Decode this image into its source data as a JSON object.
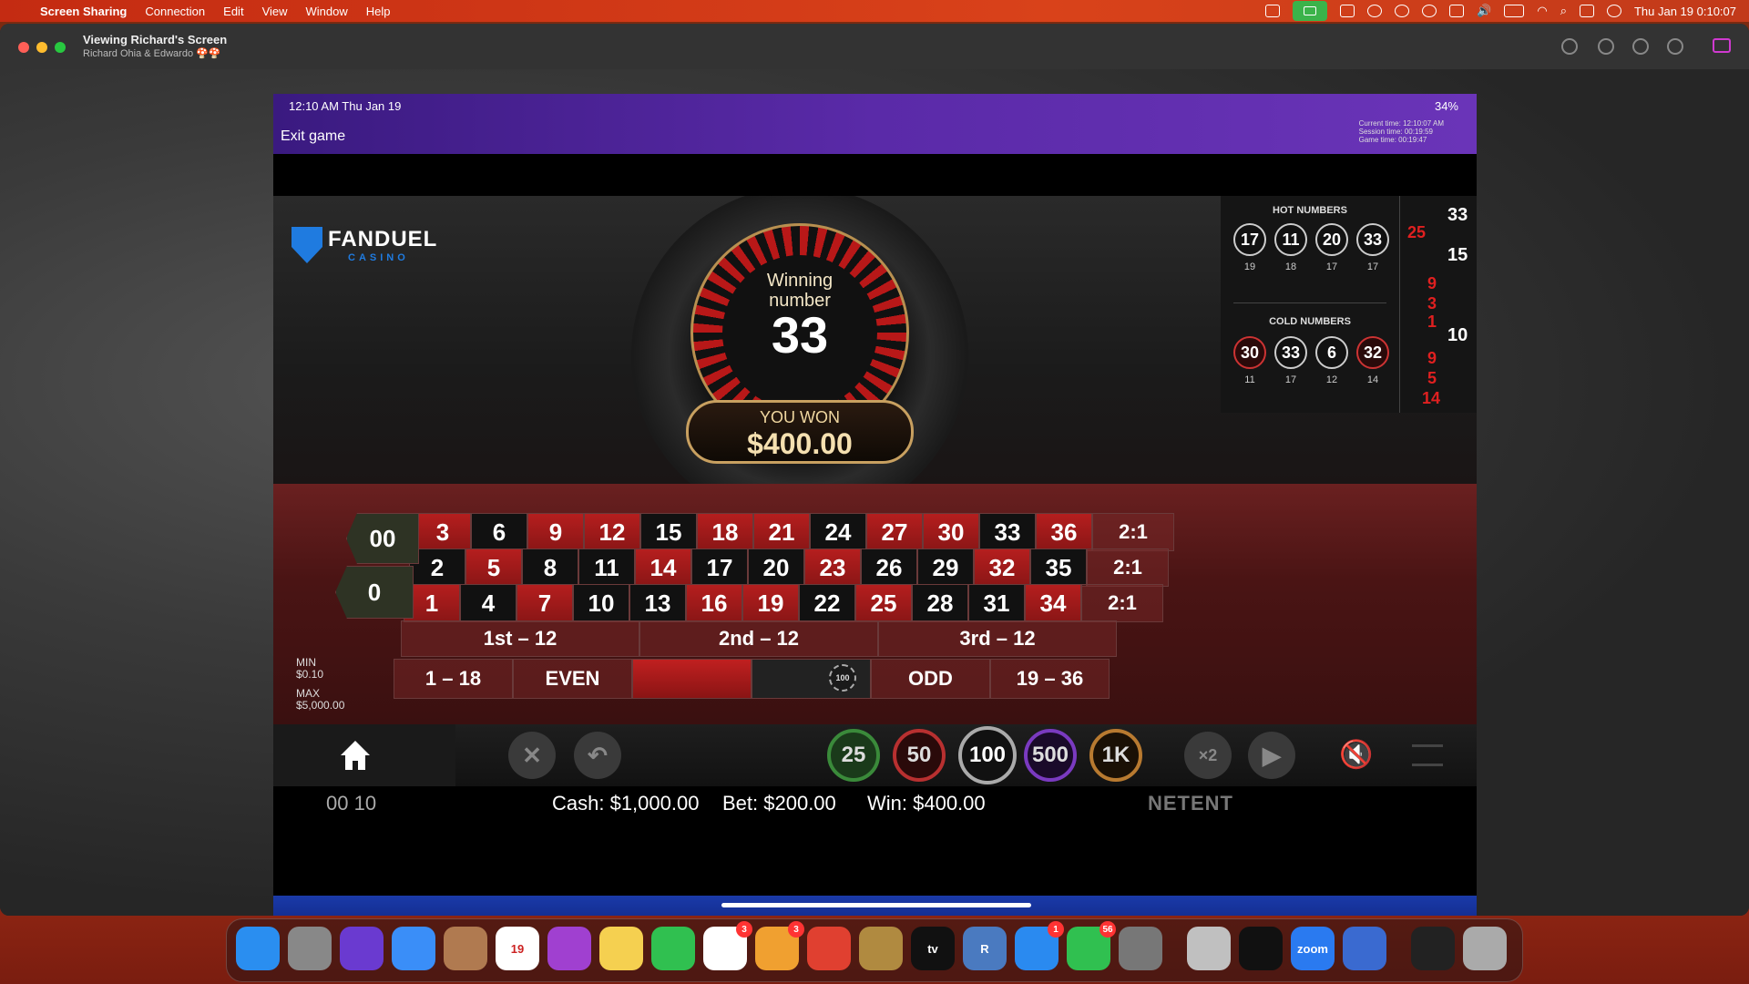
{
  "menubar": {
    "items": [
      "Screen Sharing",
      "Connection",
      "Edit",
      "View",
      "Window",
      "Help"
    ],
    "clock": "Thu Jan 19  0:10:07"
  },
  "window": {
    "title": "Viewing Richard's Screen",
    "subtitle": "Richard Ohia & Edwardo 🍄🍄"
  },
  "ipad": {
    "status_time": "12:10 AM   Thu Jan 19",
    "battery": "34%",
    "exit_label": "Exit game",
    "current_time": "Current time: 12:10:07 AM",
    "session_time": "Session time: 00:19:59",
    "game_time": "Game time: 00:19:47"
  },
  "game": {
    "brand": "FANDUEL",
    "brand_sub": "CASINO",
    "winning_label_1": "Winning",
    "winning_label_2": "number",
    "winning_number": "33",
    "you_won_label": "YOU WON",
    "you_won_amount": "$400.00",
    "hot_title": "HOT NUMBERS",
    "hot_numbers": [
      {
        "n": "17",
        "c": "19"
      },
      {
        "n": "11",
        "c": "18"
      },
      {
        "n": "20",
        "c": "17"
      },
      {
        "n": "33",
        "c": "17"
      }
    ],
    "cold_title": "COLD NUMBERS",
    "cold_numbers": [
      {
        "n": "30",
        "c": "11",
        "red": true
      },
      {
        "n": "33",
        "c": "17",
        "red": false
      },
      {
        "n": "6",
        "c": "12",
        "red": false
      },
      {
        "n": "32",
        "c": "14",
        "red": true
      }
    ],
    "recent": [
      {
        "n": "33",
        "color": "#ffffff"
      },
      {
        "n": "25",
        "color": "#e02020"
      },
      {
        "n": "15",
        "color": "#ffffff"
      },
      {
        "n": "9",
        "color": "#e02020"
      },
      {
        "n": "3",
        "color": "#e02020"
      },
      {
        "n": "1",
        "color": "#e02020"
      },
      {
        "n": "10",
        "color": "#ffffff"
      },
      {
        "n": "9",
        "color": "#e02020"
      },
      {
        "n": "5",
        "color": "#e02020"
      },
      {
        "n": "14",
        "color": "#e02020"
      }
    ]
  },
  "table": {
    "zeros": [
      "00",
      "0"
    ],
    "rows": [
      [
        "3",
        "6",
        "9",
        "12",
        "15",
        "18",
        "21",
        "24",
        "27",
        "30",
        "33",
        "36"
      ],
      [
        "2",
        "5",
        "8",
        "11",
        "14",
        "17",
        "20",
        "23",
        "26",
        "29",
        "32",
        "35"
      ],
      [
        "1",
        "4",
        "7",
        "10",
        "13",
        "16",
        "19",
        "22",
        "25",
        "28",
        "31",
        "34"
      ]
    ],
    "row_colors": [
      [
        "r",
        "b",
        "r",
        "r",
        "b",
        "r",
        "r",
        "b",
        "r",
        "r",
        "b",
        "r"
      ],
      [
        "b",
        "r",
        "b",
        "b",
        "r",
        "b",
        "b",
        "r",
        "b",
        "b",
        "r",
        "b"
      ],
      [
        "r",
        "b",
        "r",
        "b",
        "b",
        "r",
        "r",
        "b",
        "r",
        "b",
        "b",
        "r"
      ]
    ],
    "column_bets": [
      "2:1",
      "2:1",
      "2:1"
    ],
    "dozens": [
      "1st – 12",
      "2nd – 12",
      "3rd – 12"
    ],
    "outside": [
      "1 – 18",
      "EVEN",
      "",
      "",
      "ODD",
      "19 – 36"
    ],
    "placed_chip": "100",
    "min_label": "MIN",
    "min_value": "$0.10",
    "max_label": "MAX",
    "max_value": "$5,000.00"
  },
  "controls": {
    "chips": [
      "25",
      "50",
      "100",
      "500",
      "1K"
    ],
    "double_label": "×2"
  },
  "info": {
    "round_id": "00 10",
    "cash": "Cash: $1,000.00",
    "bet": "Bet: $200.00",
    "win": "Win: $400.00",
    "provider": "NETENT"
  },
  "dock": {
    "apps": [
      {
        "name": "Finder",
        "color": "#2a8ef0",
        "label": ""
      },
      {
        "name": "Launchpad",
        "color": "#888888",
        "label": ""
      },
      {
        "name": "Siri",
        "color": "#6a3ad0",
        "label": ""
      },
      {
        "name": "Mail",
        "color": "#3a8ef8",
        "label": ""
      },
      {
        "name": "Contacts",
        "color": "#b07a50",
        "label": ""
      },
      {
        "name": "Calendar",
        "color": "#ffffff",
        "label": "19"
      },
      {
        "name": "Podcasts",
        "color": "#a040d0",
        "label": ""
      },
      {
        "name": "Notes",
        "color": "#f5d050",
        "label": ""
      },
      {
        "name": "FaceTime",
        "color": "#30c050",
        "label": ""
      },
      {
        "name": "Reminders",
        "color": "#ffffff",
        "label": ""
      },
      {
        "name": "Photos",
        "color": "#f0a030",
        "label": ""
      },
      {
        "name": "Chrome",
        "color": "#e04030",
        "label": ""
      },
      {
        "name": "League of Legends",
        "color": "#b08a40",
        "label": ""
      },
      {
        "name": "Apple TV",
        "color": "#111111",
        "label": "tv"
      },
      {
        "name": "R",
        "color": "#4a7ac0",
        "label": "R"
      },
      {
        "name": "App Store",
        "color": "#2a8af0",
        "label": ""
      },
      {
        "name": "Messages",
        "color": "#30c050",
        "label": ""
      },
      {
        "name": "System Preferences",
        "color": "#777777",
        "label": ""
      },
      {
        "name": "Preview",
        "color": "#c0c0c0",
        "label": ""
      },
      {
        "name": "Activity Monitor",
        "color": "#111111",
        "label": ""
      },
      {
        "name": "Zoom",
        "color": "#2a7af0",
        "label": "zoom"
      },
      {
        "name": "Screen Sharing",
        "color": "#3a6ad0",
        "label": ""
      },
      {
        "name": "iPhone Mirroring",
        "color": "#222222",
        "label": ""
      },
      {
        "name": "Trash",
        "color": "#aaaaaa",
        "label": ""
      }
    ],
    "badges": {
      "Reminders": "3",
      "Photos": "3",
      "App Store": "1",
      "Messages": "56"
    }
  }
}
